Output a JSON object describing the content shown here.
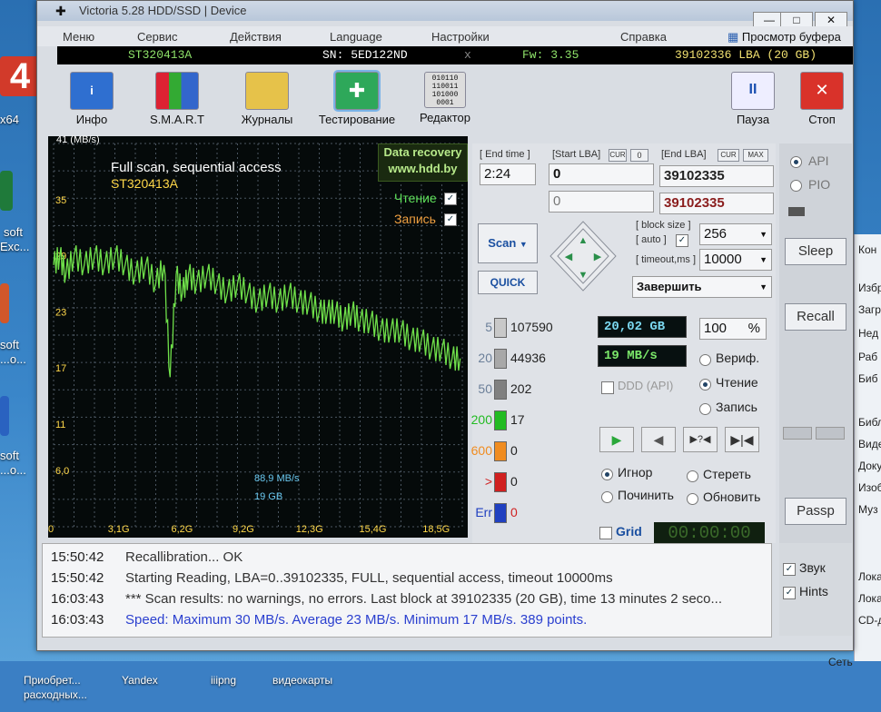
{
  "window": {
    "title": "Victoria 5.28 HDD/SSD | Device",
    "min": "—",
    "max": "□",
    "close": "✕"
  },
  "menu": [
    "Меню",
    "Сервис",
    "Действия",
    "Language",
    "Настройки",
    "Справка"
  ],
  "buffer_view": "Просмотр буфера",
  "info": {
    "model": "ST320413A",
    "serial": "SN: 5ED122ND",
    "x": "x",
    "fw": "Fw: 3.35",
    "lba": "39102336 LBA (20 GB)"
  },
  "toolbar": {
    "info": "Инфо",
    "smart": "S.M.A.R.T",
    "logs": "Журналы",
    "testing": "Тестирование",
    "editor": "Редактор",
    "pause": "Пауза",
    "stop": "Стоп",
    "editor_bits": "010110\n110011\n101000\n0001"
  },
  "graph": {
    "unit": "41 (MB/s)",
    "title": "Full scan, sequential access",
    "model": "ST320413A",
    "data_recovery": "Data recovery",
    "website": "www.hdd.by",
    "legend_read": "Чтение",
    "legend_write": "Запись",
    "y_ticks": [
      "35",
      "29",
      "23",
      "17",
      "11",
      "6,0"
    ],
    "x_ticks": [
      "0",
      "3,1G",
      "6,2G",
      "9,2G",
      "12,3G",
      "15,4G",
      "18,5G"
    ],
    "cursor_speed": "88,9 MB/s",
    "cursor_size": "19 GB"
  },
  "chart_data": {
    "type": "line",
    "ylim": [
      0,
      41
    ],
    "x_ticks": [
      "0",
      "3,1G",
      "6,2G",
      "9,2G",
      "12,3G",
      "15,4G",
      "18,5G"
    ],
    "y_ticks": [
      "35",
      "29",
      "23",
      "17",
      "11",
      "6,0"
    ],
    "series": [
      {
        "name": "Чтение",
        "x": [
          0,
          0.3,
          0.6,
          1,
          1.5,
          2,
          2.5,
          3,
          3.5,
          4,
          4.5,
          5,
          5.4,
          5.7,
          6,
          6.3,
          6.6,
          7,
          7.5,
          8,
          8.5,
          9,
          9.5,
          10,
          10.5,
          11,
          11.5,
          12,
          12.5,
          13,
          13.4,
          13.8,
          14.2,
          14.6,
          15,
          15.5,
          16,
          16.5,
          17,
          17.5,
          18,
          18.5,
          19,
          19.5,
          19.9
        ],
        "y": [
          28,
          29,
          27,
          29,
          28,
          29,
          28,
          29,
          28,
          27,
          28,
          26,
          28,
          16,
          27,
          25,
          27,
          26,
          27,
          26,
          25,
          26,
          25,
          24,
          25,
          24,
          25,
          24,
          24,
          23,
          23,
          23,
          22,
          23,
          22,
          22,
          21,
          21,
          21,
          20,
          20,
          19,
          19,
          18,
          18
        ]
      }
    ]
  },
  "ctrl": {
    "end_time_label": "[ End time ]",
    "start_lba_label": "[Start LBA]",
    "cur": "CUR",
    "zero": "0",
    "end_lba_label": "[End LBA]",
    "max": "MAX",
    "end_time": "2:24",
    "start_lba": "0",
    "end_lba": "39102335",
    "start_lba2": "0",
    "end_lba2": "39102335",
    "scan": "Scan",
    "quick": "QUICK",
    "block_size_label": "[ block size ]",
    "auto_label": "[ auto ]",
    "block_size": "256",
    "timeout_label": "[ timeout,ms ]",
    "timeout": "10000",
    "finish": "Завершить",
    "size": "20,02 GB",
    "percent": "100",
    "percent_sign": "%",
    "speed": "19 MB/s",
    "ddd": "DDD (API)",
    "verify": "Вериф.",
    "read": "Чтение",
    "write": "Запись",
    "ignore": "Игнор",
    "erase": "Стереть",
    "repair": "Починить",
    "refresh": "Обновить",
    "grid": "Grid",
    "timer": "00:00:00"
  },
  "blocks": [
    {
      "label": "5",
      "count": "107590",
      "color": "#c8c8c8"
    },
    {
      "label": "20",
      "count": "44936",
      "color": "#a8a8a8"
    },
    {
      "label": "50",
      "count": "202",
      "color": "#808080"
    },
    {
      "label": "200",
      "count": "17",
      "color": "#22bb22"
    },
    {
      "label": "600",
      "count": "0",
      "color": "#f08c20"
    },
    {
      "label": ">",
      "count": "0",
      "color": "#d02020"
    },
    {
      "label": "Err",
      "count": "0",
      "color": "#2040c0"
    }
  ],
  "rpanel": {
    "api": "API",
    "pio": "PIO",
    "sleep": "Sleep",
    "recall": "Recall",
    "passp": "Passp",
    "sound": "Звук",
    "hints": "Hints"
  },
  "log": [
    {
      "time": "15:50:42",
      "msg": "Recallibration... OK",
      "blue": false
    },
    {
      "time": "15:50:42",
      "msg": "Starting Reading, LBA=0..39102335, FULL, sequential access, timeout 10000ms",
      "blue": false
    },
    {
      "time": "16:03:43",
      "msg": "*** Scan results: no warnings, no errors. Last block at 39102335 (20 GB), time 13 minutes 2 seco...",
      "blue": false
    },
    {
      "time": "16:03:43",
      "msg": "Speed: Maximum 30 MB/s. Average 23 MB/s. Minimum 17 MB/s. 389 points.",
      "blue": true
    }
  ],
  "desktop": {
    "left_labels": [
      "4",
      "x64",
      "soft",
      "Exc...",
      "soft",
      "...о...",
      "soft",
      "...о..."
    ],
    "right_items": [
      "Кон",
      "Избра",
      "Загр",
      "Нед",
      "Раб",
      "Биб",
      "Библ",
      "Виде",
      "Доку",
      "Изоб",
      "Муз",
      "Лока",
      "Лока",
      "CD-д",
      "Сеть"
    ],
    "taskbar": [
      "Приобрет...",
      "расходных...",
      "Yandex",
      "iiipng",
      "видеокарты"
    ]
  }
}
